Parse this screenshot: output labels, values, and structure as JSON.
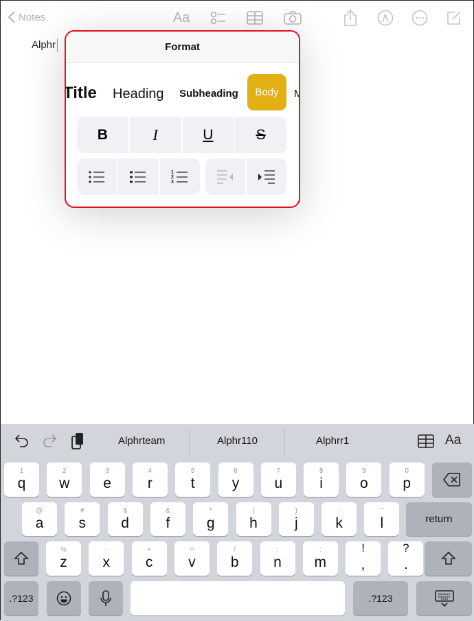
{
  "topbar": {
    "back_label": "Notes",
    "icons": [
      "chevron-left-icon",
      "text-format-icon",
      "checklist-icon",
      "table-icon",
      "camera-icon",
      "share-icon",
      "markup-icon",
      "more-icon",
      "compose-icon"
    ]
  },
  "note": {
    "text": "Alphr"
  },
  "format": {
    "title": "Format",
    "styles": [
      {
        "label": "Title"
      },
      {
        "label": "Heading"
      },
      {
        "label": "Subheading"
      },
      {
        "label": "Body",
        "selected": true
      },
      {
        "label": "M"
      }
    ],
    "accent": "#e2b014",
    "text_buttons": [
      {
        "label": "B",
        "name": "bold"
      },
      {
        "label": "I",
        "name": "italic"
      },
      {
        "label": "U",
        "name": "underline"
      },
      {
        "label": "S",
        "name": "strikethrough"
      }
    ],
    "list_buttons": [
      "dashed-list-icon",
      "bulleted-list-icon",
      "numbered-list-icon"
    ],
    "indent_buttons": [
      "outdent-icon",
      "indent-icon"
    ],
    "highlight_border": "#e0101a"
  },
  "keyboard": {
    "suggestions": [
      "Alphrteam",
      "Alphr110",
      "Alphrr1"
    ],
    "rows": [
      [
        {
          "p": "q",
          "s": "1"
        },
        {
          "p": "w",
          "s": "2"
        },
        {
          "p": "e",
          "s": "3"
        },
        {
          "p": "r",
          "s": "4"
        },
        {
          "p": "t",
          "s": "5"
        },
        {
          "p": "y",
          "s": "6"
        },
        {
          "p": "u",
          "s": "7"
        },
        {
          "p": "i",
          "s": "8"
        },
        {
          "p": "o",
          "s": "9"
        },
        {
          "p": "p",
          "s": "0"
        }
      ],
      [
        {
          "p": "a",
          "s": "@"
        },
        {
          "p": "s",
          "s": "#"
        },
        {
          "p": "d",
          "s": "$"
        },
        {
          "p": "f",
          "s": "&"
        },
        {
          "p": "g",
          "s": "*"
        },
        {
          "p": "h",
          "s": "("
        },
        {
          "p": "j",
          "s": ")"
        },
        {
          "p": "k",
          "s": "'"
        },
        {
          "p": "l",
          "s": "\""
        }
      ],
      [
        {
          "p": "z",
          "s": "%"
        },
        {
          "p": "x",
          "s": "-"
        },
        {
          "p": "c",
          "s": "+"
        },
        {
          "p": "v",
          "s": "="
        },
        {
          "p": "b",
          "s": "/"
        },
        {
          "p": "n",
          "s": ";"
        },
        {
          "p": "m",
          "s": ":"
        },
        {
          "p": ",",
          "s": "!"
        },
        {
          "p": ".",
          "s": "?"
        }
      ]
    ],
    "return_label": "return",
    "numbers_label": ".?123",
    "format_label": "Aa"
  }
}
